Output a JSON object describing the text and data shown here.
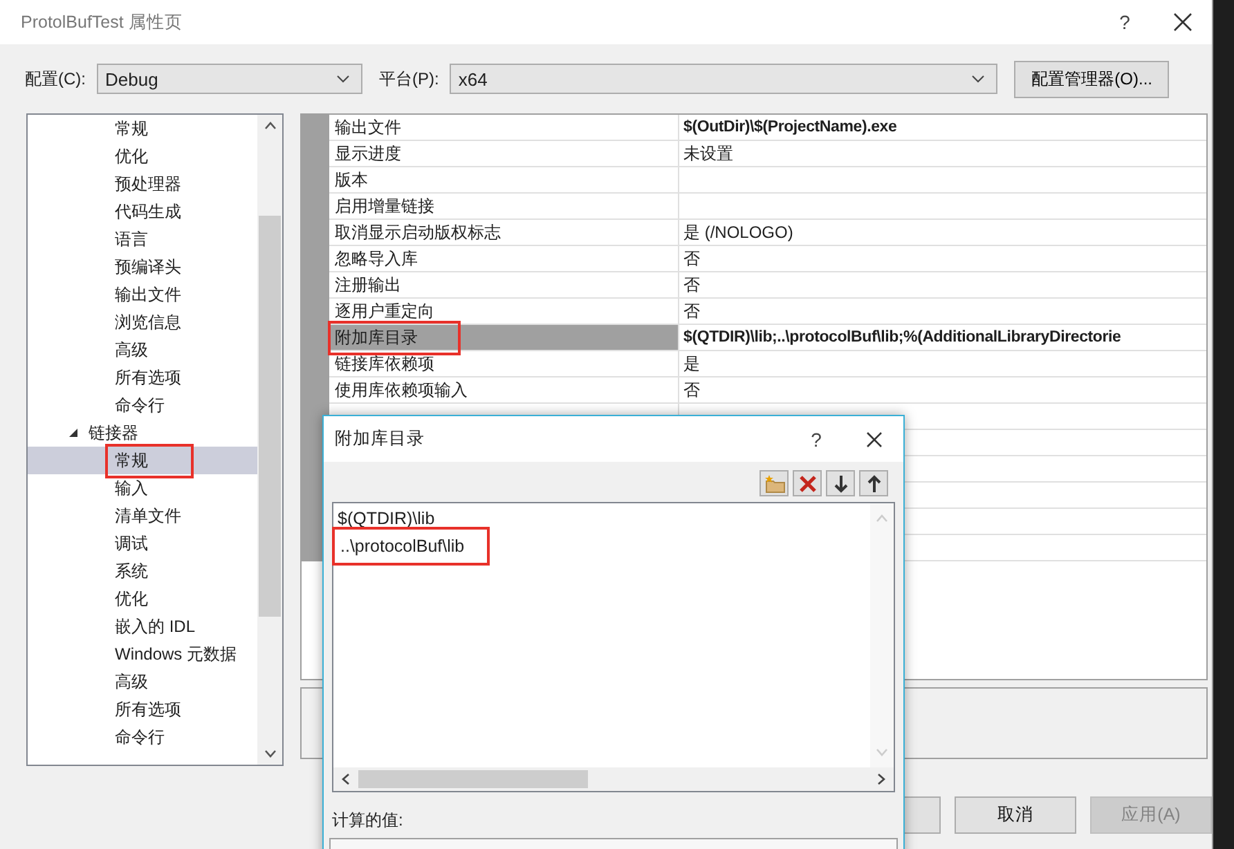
{
  "window": {
    "title": "ProtolBufTest 属性页",
    "help": "?"
  },
  "config": {
    "label": "配置(C):",
    "value": "Debug"
  },
  "platform": {
    "label": "平台(P):",
    "value": "x64"
  },
  "manager_button": "配置管理器(O)...",
  "tree": [
    {
      "children": [
        {
          "label": "常规",
          "selected": false,
          "annotated": false
        },
        {
          "label": "优化",
          "selected": false,
          "annotated": false
        },
        {
          "label": "预处理器",
          "selected": false,
          "annotated": false
        },
        {
          "label": "代码生成",
          "selected": false,
          "annotated": false
        },
        {
          "label": "语言",
          "selected": false,
          "annotated": false
        },
        {
          "label": "预编译头",
          "selected": false,
          "annotated": false
        },
        {
          "label": "输出文件",
          "selected": false,
          "annotated": false
        },
        {
          "label": "浏览信息",
          "selected": false,
          "annotated": false
        },
        {
          "label": "高级",
          "selected": false,
          "annotated": false
        },
        {
          "label": "所有选项",
          "selected": false,
          "annotated": false
        },
        {
          "label": "命令行",
          "selected": false,
          "annotated": false
        }
      ]
    },
    {
      "label": "链接器",
      "expanded": true,
      "selected": false,
      "annotated": false,
      "children": [
        {
          "label": "常规",
          "selected": true,
          "annotated": true
        },
        {
          "label": "输入",
          "selected": false,
          "annotated": false
        },
        {
          "label": "清单文件",
          "selected": false,
          "annotated": false
        },
        {
          "label": "调试",
          "selected": false,
          "annotated": false
        },
        {
          "label": "系统",
          "selected": false,
          "annotated": false
        },
        {
          "label": "优化",
          "selected": false,
          "annotated": false
        },
        {
          "label": "嵌入的 IDL",
          "selected": false,
          "annotated": false
        },
        {
          "label": "Windows 元数据",
          "selected": false,
          "annotated": false
        },
        {
          "label": "高级",
          "selected": false,
          "annotated": false
        },
        {
          "label": "所有选项",
          "selected": false,
          "annotated": false
        },
        {
          "label": "命令行",
          "selected": false,
          "annotated": false
        }
      ]
    }
  ],
  "properties": [
    {
      "label": "输出文件",
      "value": "$(OutDir)\\$(ProjectName).exe",
      "modified": true,
      "selected": false,
      "annotated": false
    },
    {
      "label": "显示进度",
      "value": "未设置",
      "modified": false,
      "selected": false,
      "annotated": false
    },
    {
      "label": "版本",
      "selected": false,
      "annotated": false
    },
    {
      "label": "启用增量链接",
      "selected": false,
      "annotated": false
    },
    {
      "label": "取消显示启动版权标志",
      "value": "是 (/NOLOGO)",
      "modified": false,
      "selected": false,
      "annotated": false
    },
    {
      "label": "忽略导入库",
      "value": "否",
      "modified": false,
      "selected": false,
      "annotated": false
    },
    {
      "label": "注册输出",
      "value": "否",
      "modified": false,
      "selected": false,
      "annotated": false
    },
    {
      "label": "逐用户重定向",
      "value": "否",
      "modified": false,
      "selected": false,
      "annotated": false
    },
    {
      "label": "附加库目录",
      "value": "$(QTDIR)\\lib;..\\protocolBuf\\lib;%(AdditionalLibraryDirectorie",
      "modified": true,
      "selected": true,
      "annotated": true
    },
    {
      "label": "链接库依赖项",
      "value": "是",
      "modified": false,
      "selected": false,
      "annotated": false
    },
    {
      "label": "使用库依赖项输入",
      "value": "否",
      "modified": false,
      "selected": false,
      "annotated": false
    }
  ],
  "buttons": [
    {
      "label": "取消",
      "disabled": false
    },
    {
      "label": "应用(A)",
      "disabled": true
    }
  ],
  "dialog": {
    "title": "附加库目录",
    "help": "?",
    "entries": [
      {
        "text": "$(QTDIR)\\lib",
        "annotated": false
      },
      {
        "text": "..\\protocolBuf\\lib",
        "annotated": true
      }
    ],
    "computed_label": "计算的值:"
  }
}
